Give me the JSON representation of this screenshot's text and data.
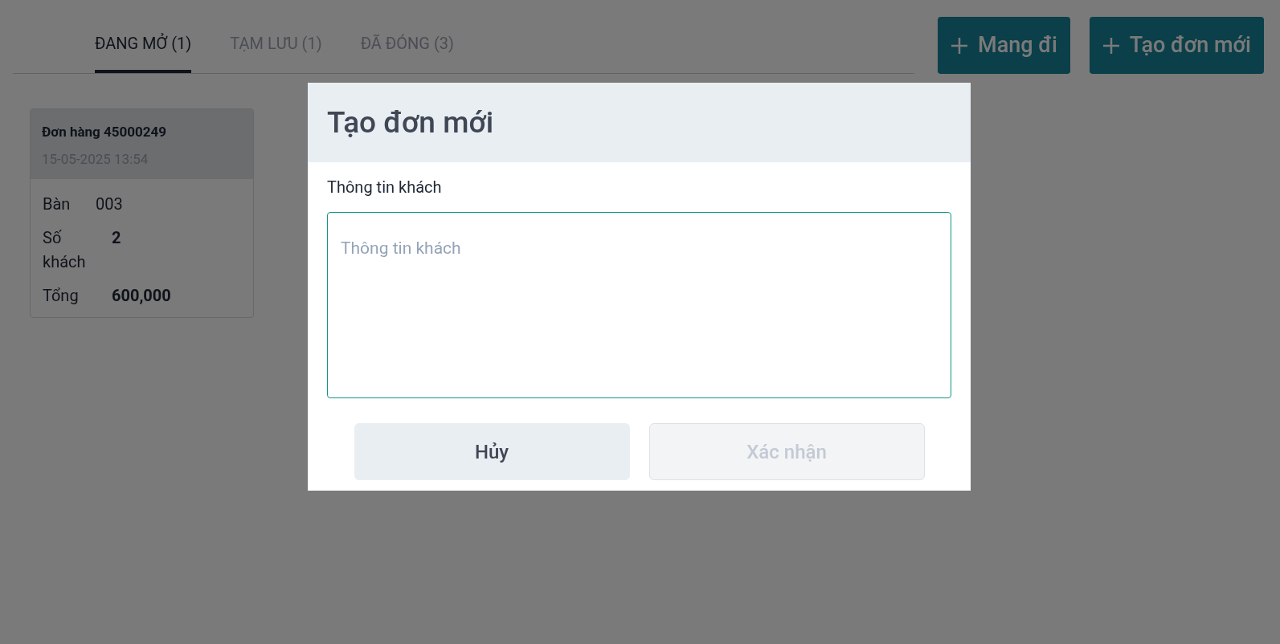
{
  "tabs": [
    {
      "label": "ĐANG MỞ (1)",
      "selected": true
    },
    {
      "label": "TẠM LƯU (1)",
      "selected": false
    },
    {
      "label": "ĐÃ ĐÓNG (3)",
      "selected": false
    }
  ],
  "actions": [
    {
      "label": "Mang đi"
    },
    {
      "label": "Tạo đơn mới"
    }
  ],
  "orders": [
    {
      "title": "Đơn hàng 45000249",
      "time": "15-05-2025 13:54",
      "fields": [
        {
          "label": "Bàn",
          "value": "003",
          "bold": false
        },
        {
          "label": "Số khách",
          "value": "2",
          "bold": true
        },
        {
          "label": "Tổng",
          "value": "600,000",
          "bold": true
        }
      ]
    }
  ],
  "dialog": {
    "title": "Tạo đơn mới",
    "field_label": "Thông tin khách",
    "placeholder": "Thông tin khách",
    "buttons": [
      {
        "label": "Hủy",
        "disabled": false
      },
      {
        "label": "Xác nhận",
        "disabled": true
      }
    ]
  }
}
